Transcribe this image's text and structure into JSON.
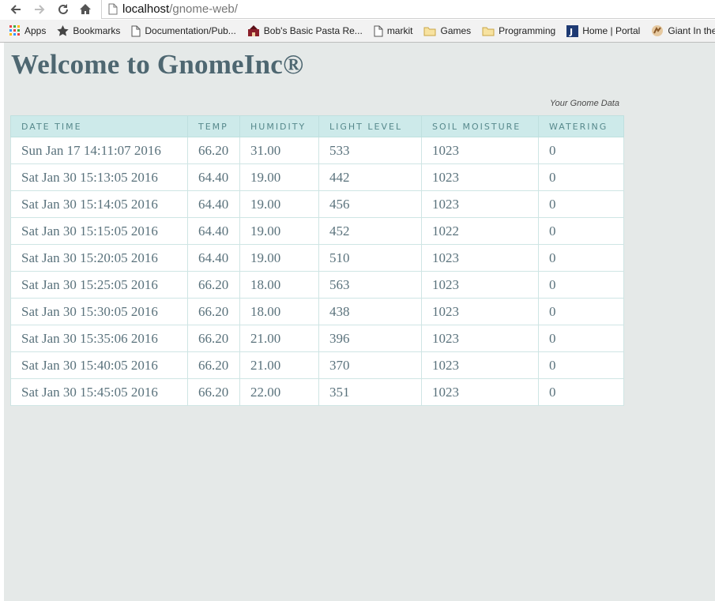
{
  "browser": {
    "url_host": "localhost",
    "url_path": "/gnome-web/",
    "bookmarks": [
      {
        "label": "Apps",
        "icon": "apps-grid-icon"
      },
      {
        "label": "Bookmarks",
        "icon": "star-icon"
      },
      {
        "label": "Documentation/Pub...",
        "icon": "page-icon"
      },
      {
        "label": "Bob's Basic Pasta Re...",
        "icon": "site-favicon-icon"
      },
      {
        "label": "markit",
        "icon": "page-icon"
      },
      {
        "label": "Games",
        "icon": "folder-icon"
      },
      {
        "label": "Programming",
        "icon": "folder-icon"
      },
      {
        "label": "Home | Portal",
        "icon": "j-favicon-icon"
      },
      {
        "label": "Giant In the P",
        "icon": "giant-favicon-icon"
      }
    ]
  },
  "page": {
    "title": "Welcome to GnomeInc®",
    "caption": "Your Gnome Data",
    "columns": [
      "Date Time",
      "Temp",
      "Humidity",
      "Light Level",
      "Soil Moisture",
      "Watering"
    ],
    "rows": [
      [
        "Sun Jan 17 14:11:07 2016",
        "66.20",
        "31.00",
        "533",
        "1023",
        "0"
      ],
      [
        "Sat Jan 30 15:13:05 2016",
        "64.40",
        "19.00",
        "442",
        "1023",
        "0"
      ],
      [
        "Sat Jan 30 15:14:05 2016",
        "64.40",
        "19.00",
        "456",
        "1023",
        "0"
      ],
      [
        "Sat Jan 30 15:15:05 2016",
        "64.40",
        "19.00",
        "452",
        "1022",
        "0"
      ],
      [
        "Sat Jan 30 15:20:05 2016",
        "64.40",
        "19.00",
        "510",
        "1023",
        "0"
      ],
      [
        "Sat Jan 30 15:25:05 2016",
        "66.20",
        "18.00",
        "563",
        "1023",
        "0"
      ],
      [
        "Sat Jan 30 15:30:05 2016",
        "66.20",
        "18.00",
        "438",
        "1023",
        "0"
      ],
      [
        "Sat Jan 30 15:35:06 2016",
        "66.20",
        "21.00",
        "396",
        "1023",
        "0"
      ],
      [
        "Sat Jan 30 15:40:05 2016",
        "66.20",
        "21.00",
        "370",
        "1023",
        "0"
      ],
      [
        "Sat Jan 30 15:45:05 2016",
        "66.20",
        "22.00",
        "351",
        "1023",
        "0"
      ]
    ]
  },
  "colors": {
    "page_bg": "#e5e9e8",
    "title": "#4e6771",
    "header_bg": "#cdeaea",
    "header_text": "#57898c",
    "cell_text": "#5a727c"
  }
}
